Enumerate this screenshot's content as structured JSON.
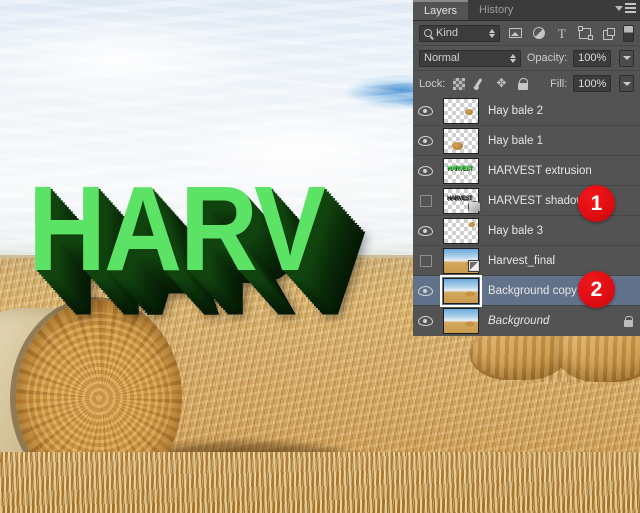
{
  "canvas": {
    "artwork_text": "HARV",
    "artwork_text_color": "#5ce265",
    "artwork_extrusion_color": "#11430f",
    "scene": "harvest field with round hay bales under a cloudy blue sky"
  },
  "panel": {
    "tabs": [
      {
        "label": "Layers",
        "active": true
      },
      {
        "label": "History",
        "active": false
      }
    ],
    "menu_icon": "panel-menu-icon",
    "filter": {
      "kind_label": "Kind",
      "search_icon": "search-icon",
      "stepper_icon": "stepper-icon",
      "filter_icons": [
        "pixel-layer-filter-icon",
        "adjustment-layer-filter-icon",
        "type-layer-filter-icon",
        "shape-layer-filter-icon",
        "smart-object-filter-icon"
      ],
      "type_glyph": "T",
      "toggle_icon": "filter-toggle-icon"
    },
    "blend": {
      "mode": "Normal",
      "opacity_label": "Opacity:",
      "opacity_value": "100%",
      "dropdown_icon": "chevron-down-icon"
    },
    "lock": {
      "label": "Lock:",
      "icons": [
        "lock-transparent-pixels-icon",
        "lock-image-pixels-icon",
        "lock-position-icon",
        "lock-all-icon"
      ],
      "fill_label": "Fill:",
      "fill_value": "100%",
      "dropdown_icon": "chevron-down-icon"
    },
    "layers": [
      {
        "name": "Hay bale 2",
        "visible": true,
        "selected": false,
        "locked": false,
        "thumb": "checker",
        "italic": false,
        "badge": ""
      },
      {
        "name": "Hay bale 1",
        "visible": true,
        "selected": false,
        "locked": false,
        "thumb": "checker",
        "italic": false,
        "badge": ""
      },
      {
        "name": "HARVEST extrusion",
        "visible": true,
        "selected": false,
        "locked": false,
        "thumb": "text-green",
        "italic": false,
        "badge": ""
      },
      {
        "name": "HARVEST shadow",
        "visible": false,
        "selected": false,
        "locked": false,
        "thumb": "text-black",
        "italic": false,
        "badge": "3d"
      },
      {
        "name": "Hay bale 3",
        "visible": true,
        "selected": false,
        "locked": false,
        "thumb": "checker",
        "italic": false,
        "badge": ""
      },
      {
        "name": "Harvest_final",
        "visible": false,
        "selected": false,
        "locked": false,
        "thumb": "photo",
        "italic": false,
        "badge": "smart"
      },
      {
        "name": "Background copy",
        "visible": true,
        "selected": true,
        "locked": false,
        "thumb": "photo",
        "italic": false,
        "badge": ""
      },
      {
        "name": "Background",
        "visible": true,
        "selected": false,
        "locked": true,
        "thumb": "photo",
        "italic": true,
        "badge": ""
      }
    ],
    "thumb_text_green": "HARVEST",
    "thumb_text_black": "HARVEST"
  },
  "callouts": [
    {
      "number": "1",
      "target_layer": "HARVEST shadow",
      "color": "#e00d12"
    },
    {
      "number": "2",
      "target_layer": "Background copy",
      "color": "#e00d12"
    }
  ]
}
